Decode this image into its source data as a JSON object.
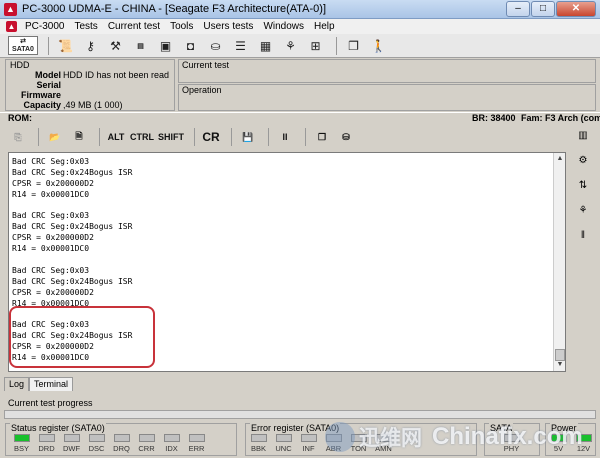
{
  "window": {
    "title": "PC-3000 UDMA-E - CHINA - [Seagate F3 Architecture(ATA-0)]",
    "controls": [
      "–",
      "□",
      "✕"
    ]
  },
  "menu": [
    "PC-3000",
    "Tests",
    "Current test",
    "Tools",
    "Users tests",
    "Windows",
    "Help"
  ],
  "toolbar": {
    "sata_label": "SATA0",
    "buttons": [
      "sata-port-icon",
      "scroll-icon",
      "key-icon",
      "wrench-icon",
      "hdd-id-icon",
      "chip-icon",
      "chip-2-icon",
      "disk-drive-icon",
      "stack-icon",
      "grid-icon",
      "tree-icon",
      "flowchart-icon",
      "copy-window-icon",
      "walking-man-icon"
    ]
  },
  "hdd": {
    "legend": "HDD",
    "model_label": "Model",
    "model_value": "HDD ID has not been read",
    "serial_label": "Serial",
    "serial_value": "",
    "firmware_label": "Firmware",
    "firmware_value": "",
    "capacity_label": "Capacity",
    "capacity_value": ",49 MB (1 000)"
  },
  "panels": {
    "current_test": "Current test",
    "operation": "Operation"
  },
  "rom_bar": {
    "rom": "ROM:",
    "br": "BR: 38400",
    "fam": "Fam: F3 Arch (comm"
  },
  "terminal_toolbar": {
    "alt": "ALT",
    "ctrl": "CTRL",
    "shift": "SHIFT",
    "cr": "CR",
    "pause": "II"
  },
  "terminal": {
    "lines": [
      "Bad CRC Seg:0x03",
      "Bad CRC Seg:0x24Bogus ISR",
      "CPSR = 0x200000D2",
      "R14 = 0x00001DC0",
      "",
      "Bad CRC Seg:0x03",
      "Bad CRC Seg:0x24Bogus ISR",
      "CPSR = 0x200000D2",
      "R14 = 0x00001DC0",
      "",
      "Bad CRC Seg:0x03",
      "Bad CRC Seg:0x24Bogus ISR",
      "CPSR = 0x200000D2",
      "R14 = 0x00001DC0",
      "",
      "Bad CRC Seg:0x03",
      "Bad CRC Seg:0x24Bogus ISR",
      "CPSR = 0x200000D2",
      "R14 = 0x00001DC0"
    ]
  },
  "tabs": [
    "Log",
    "Terminal"
  ],
  "progress": {
    "label": "Current test progress",
    "value": 0
  },
  "status_register": {
    "legend": "Status register (SATA0)",
    "bits": [
      {
        "name": "BSY",
        "on": true
      },
      {
        "name": "DRD",
        "on": false
      },
      {
        "name": "DWF",
        "on": false
      },
      {
        "name": "DSC",
        "on": false
      },
      {
        "name": "DRQ",
        "on": false
      },
      {
        "name": "CRR",
        "on": false
      },
      {
        "name": "IDX",
        "on": false
      },
      {
        "name": "ERR",
        "on": false
      }
    ]
  },
  "error_register": {
    "legend": "Error register (SATA0)",
    "bits": [
      {
        "name": "BBK",
        "on": false
      },
      {
        "name": "UNC",
        "on": false
      },
      {
        "name": "INF",
        "on": false
      },
      {
        "name": "ABR",
        "on": false
      },
      {
        "name": "TON",
        "on": false
      },
      {
        "name": "AMN",
        "on": false
      }
    ]
  },
  "sata": {
    "legend": "SATA",
    "bits": [
      {
        "name": "PHY",
        "on": false
      }
    ]
  },
  "power": {
    "legend": "Power",
    "bits": [
      {
        "name": "5V",
        "on": true
      },
      {
        "name": "12V",
        "on": true
      }
    ]
  },
  "watermark": {
    "cn": "迅维网",
    "en": "Chinafix.com"
  },
  "colors": {
    "led_on": "#18c02c",
    "highlight": "#c8323a"
  }
}
